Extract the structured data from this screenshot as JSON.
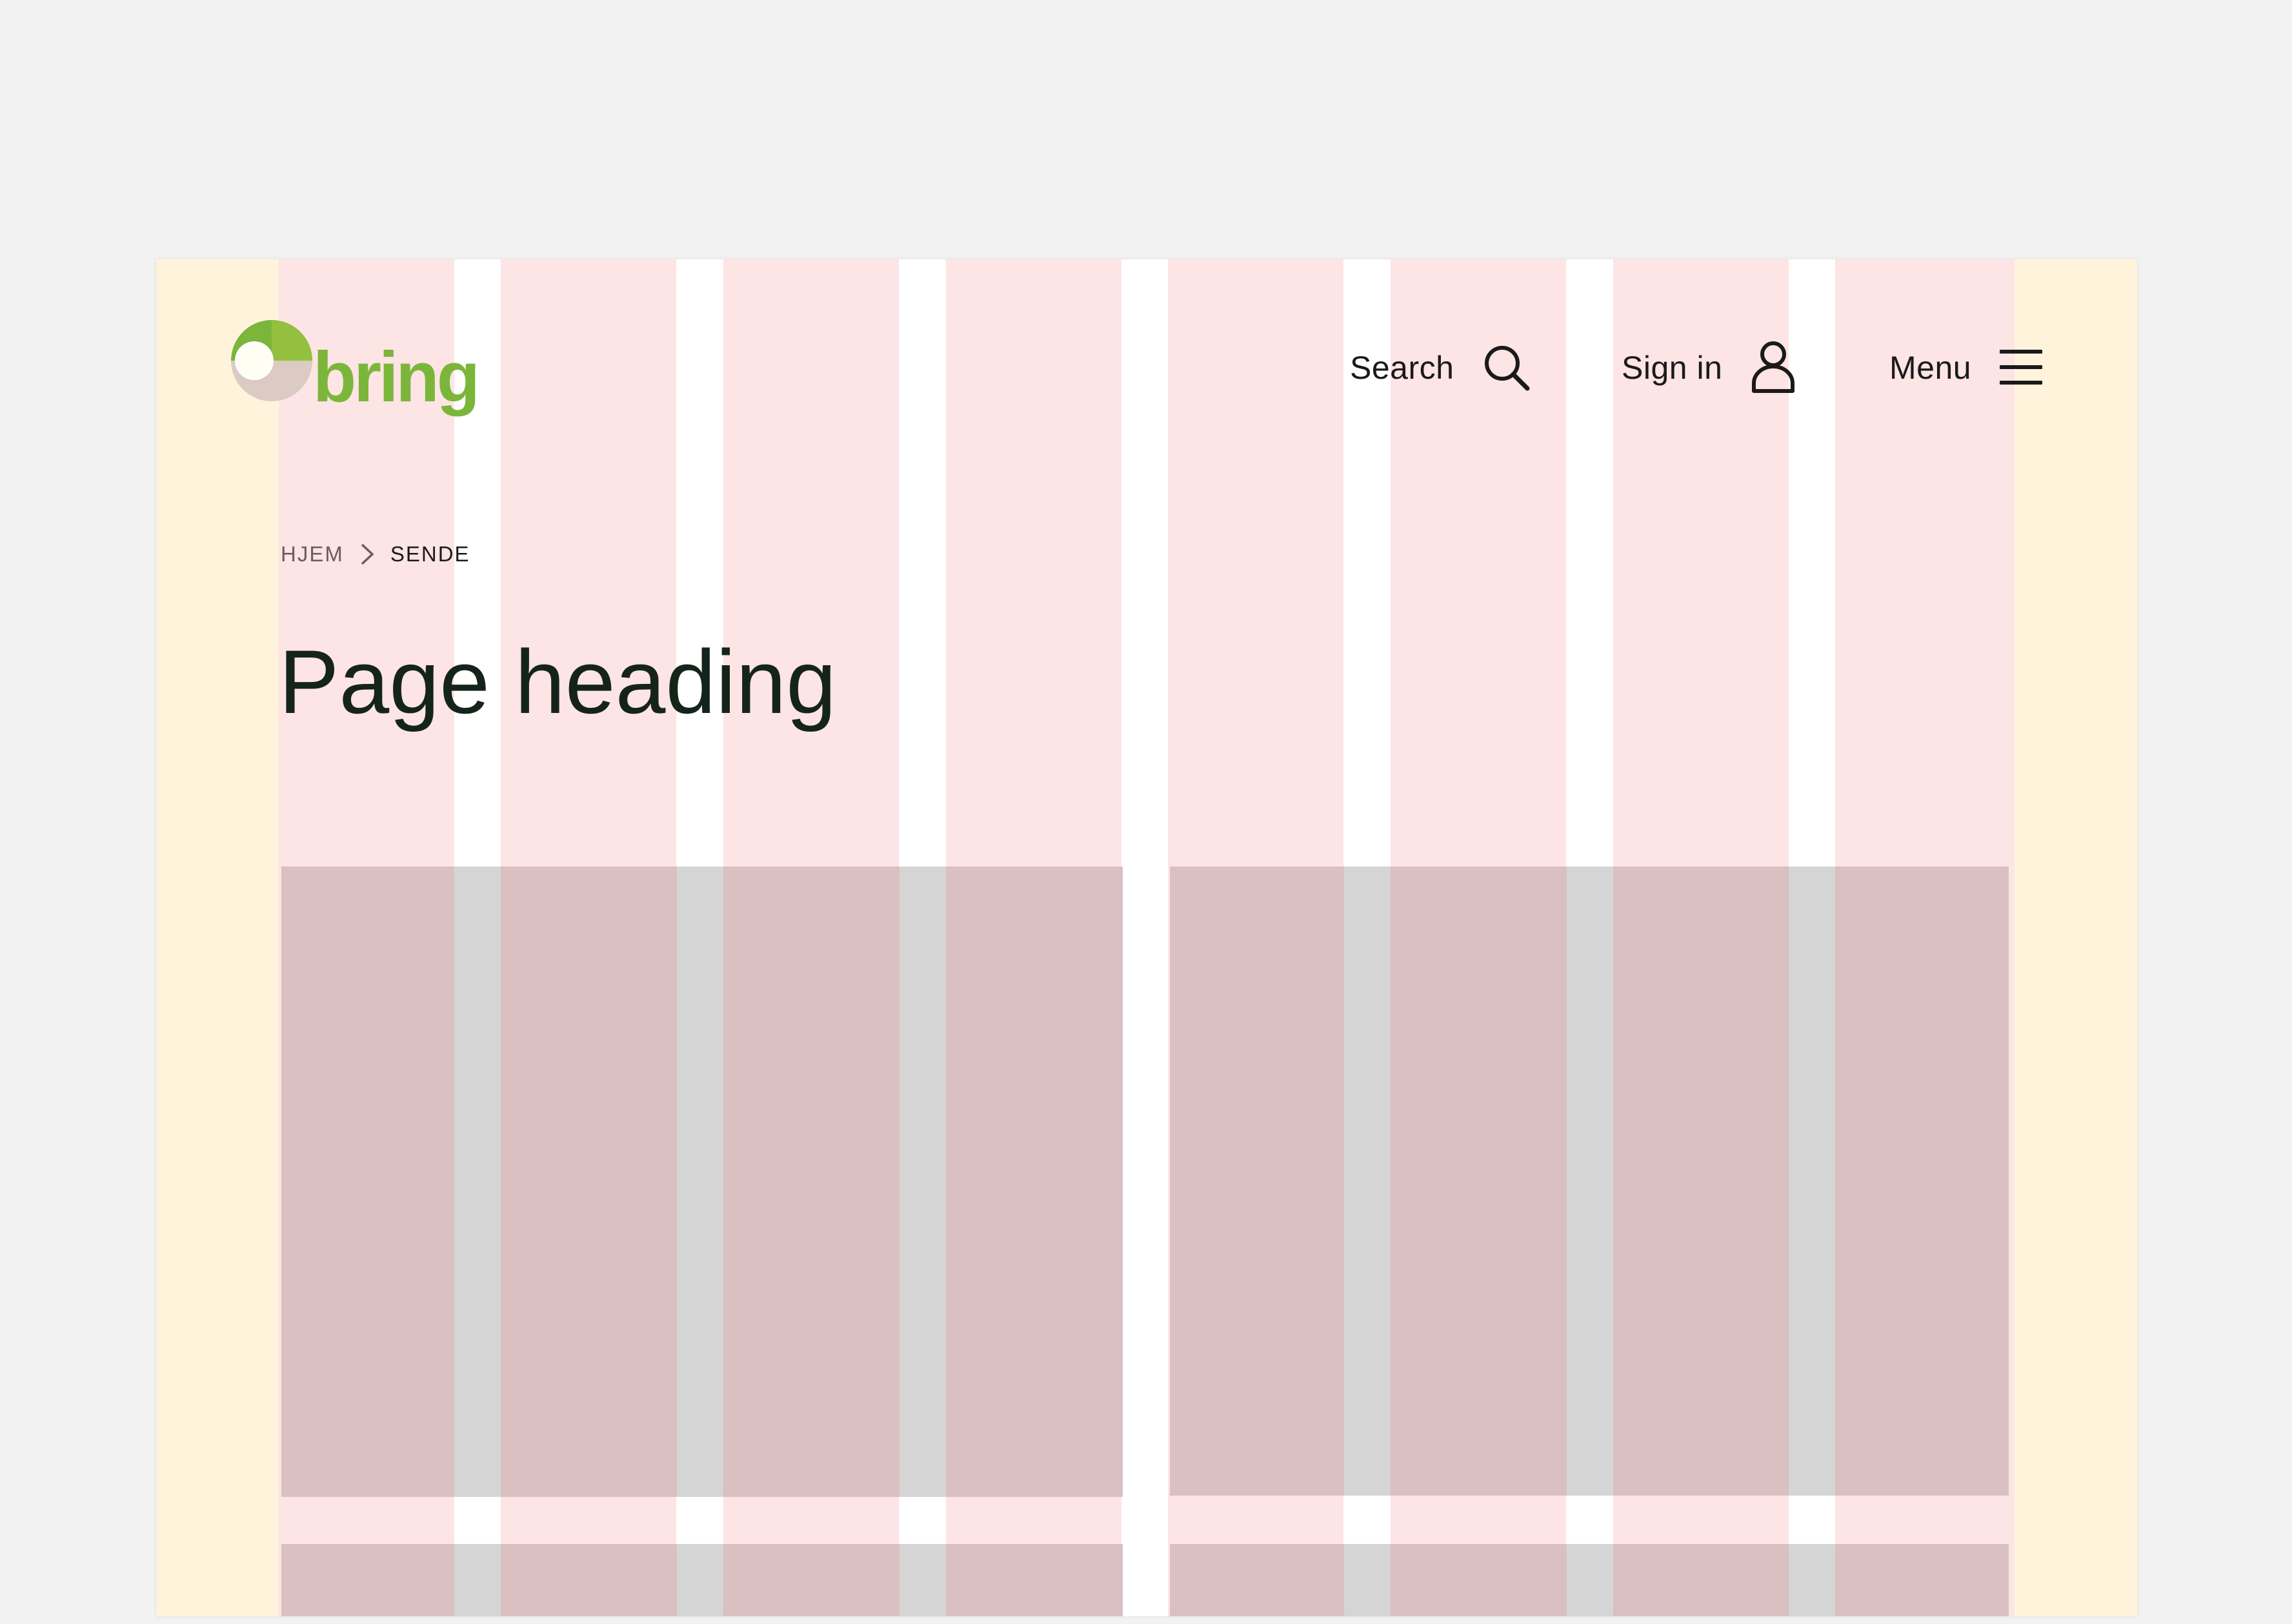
{
  "brand": {
    "name": "bring",
    "colors": {
      "green": "#7bb63b",
      "dark_green": "#5a9a2a",
      "beige": "#dccbc2"
    }
  },
  "header": {
    "search_label": "Search",
    "signin_label": "Sign in",
    "menu_label": "Menu",
    "search_icon": "search-icon",
    "signin_icon": "user-icon",
    "menu_icon": "hamburger-menu-icon"
  },
  "breadcrumb": {
    "items": [
      "HJEM",
      "SENDE"
    ],
    "separator_icon": "chevron-right-icon"
  },
  "main": {
    "heading": "Page heading"
  },
  "grid_overlay": {
    "columns": 8,
    "colors": {
      "margin": "#fff3dc",
      "column": "#fde4e5",
      "gutter": "#ffffff",
      "content_block": "#dac0c1",
      "gutter_block": "#d5d5d5"
    }
  }
}
